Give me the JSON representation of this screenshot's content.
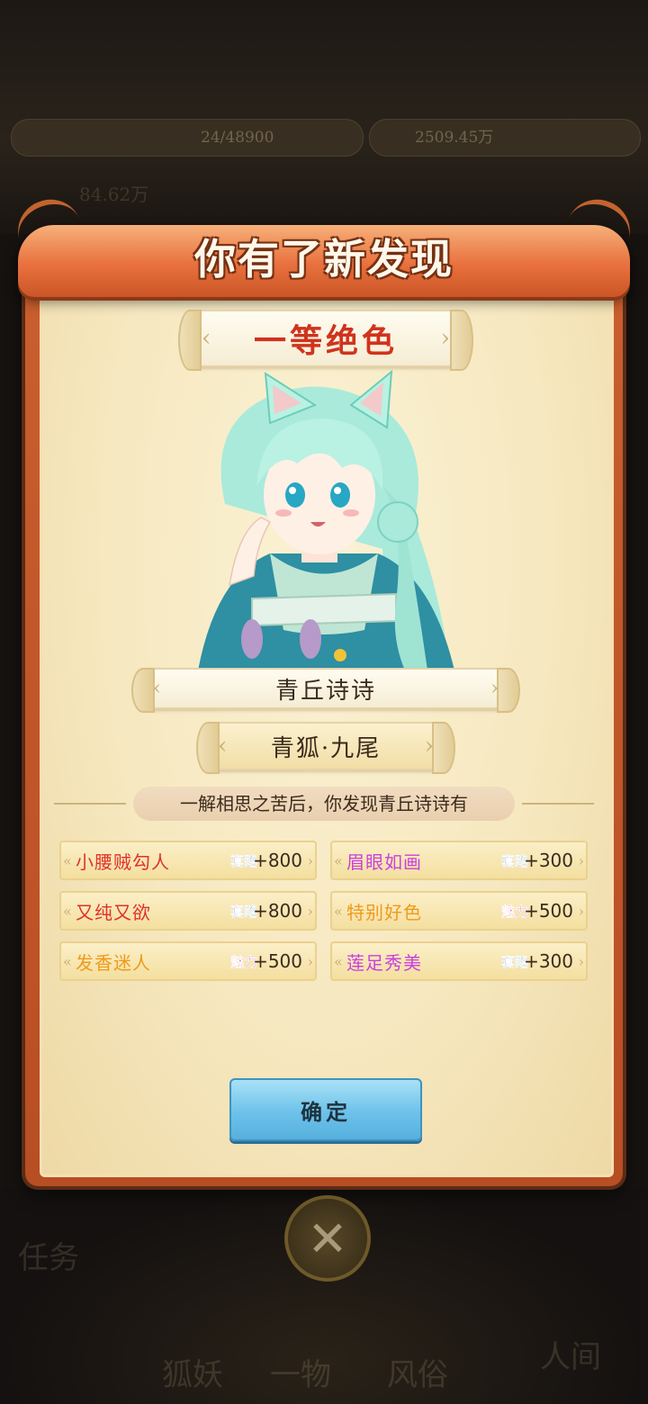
{
  "header": {
    "title": "你有了新发现"
  },
  "rank": "一等绝色",
  "character": {
    "name": "青丘诗诗",
    "title": "青狐·九尾"
  },
  "description": "一解相思之苦后，你发现青丘诗诗有",
  "traits": [
    {
      "name": "小腰贼勾人",
      "stat": "套路",
      "value": "+800",
      "name_color": "#e0322a",
      "badge_color": "#2b73e0"
    },
    {
      "name": "眉眼如画",
      "stat": "套路",
      "value": "+300",
      "name_color": "#c93fe0",
      "badge_color": "#2b73e0"
    },
    {
      "name": "又纯又欲",
      "stat": "套路",
      "value": "+800",
      "name_color": "#e0322a",
      "badge_color": "#2b73e0"
    },
    {
      "name": "特别好色",
      "stat": "魅力",
      "value": "+500",
      "name_color": "#f09a1a",
      "badge_color": "#d42fc4"
    },
    {
      "name": "发香迷人",
      "stat": "魅力",
      "value": "+500",
      "name_color": "#f09a1a",
      "badge_color": "#d42fc4"
    },
    {
      "name": "莲足秀美",
      "stat": "套路",
      "value": "+300",
      "name_color": "#c93fe0",
      "badge_color": "#2b73e0"
    }
  ],
  "confirm_label": "确定",
  "close_icon": "close-icon",
  "background": {
    "hud_left": "24/48900",
    "hud_right": "2509.45万",
    "stat_value": "84.62万",
    "bottom_labels": [
      "任务",
      "狐妖",
      "一物",
      "风俗",
      "人间"
    ]
  }
}
